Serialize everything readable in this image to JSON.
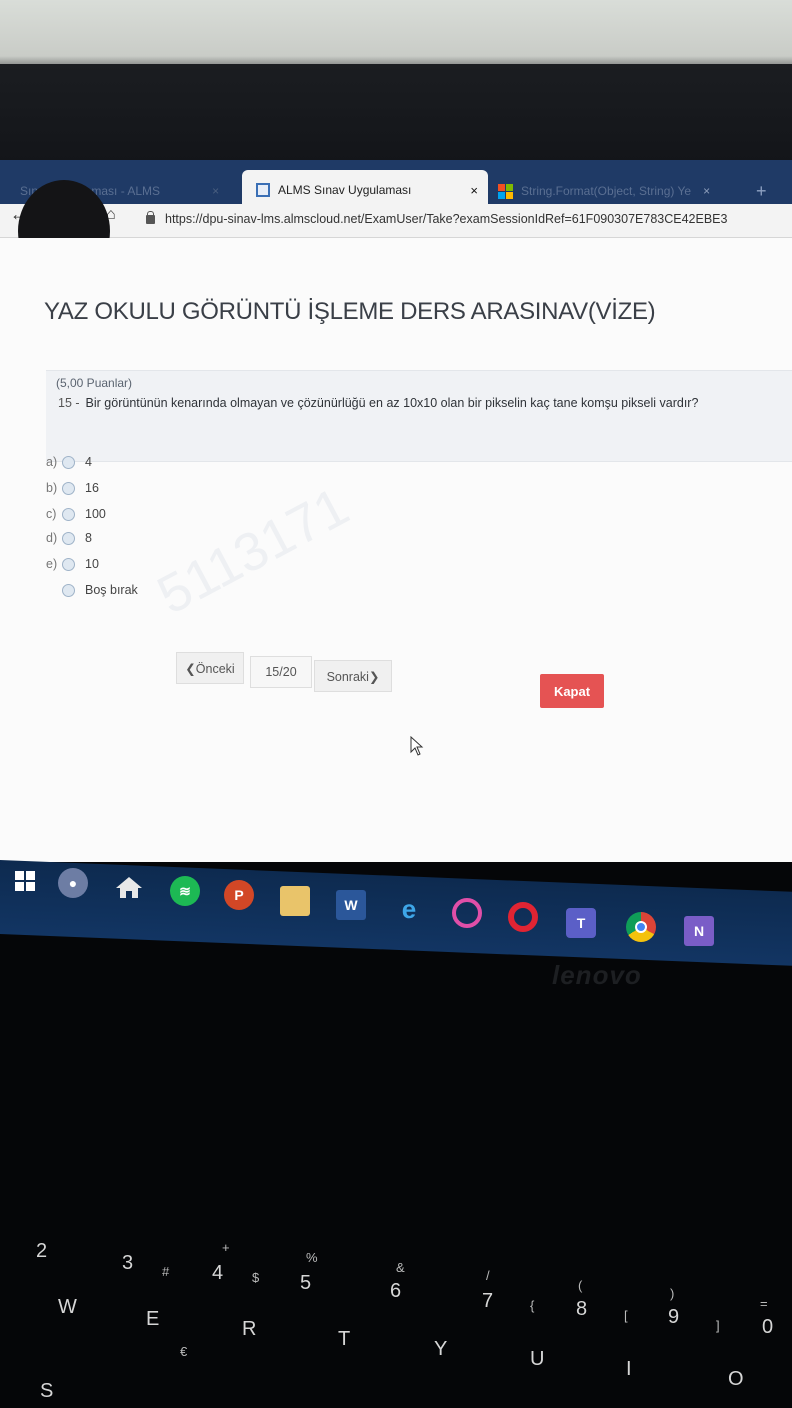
{
  "browser": {
    "tabs": [
      {
        "label": "Sınav Uygulaması - ALMS"
      },
      {
        "label": "ALMS Sınav Uygulaması",
        "close": "×"
      },
      {
        "label": "String.Format(Object, String) Ye",
        "close": "×"
      }
    ],
    "new_tab": "+",
    "url": "https://dpu-sinav-lms.almscloud.net/ExamUser/Take?examSessionIdRef=61F090307E783CE42EBE3"
  },
  "exam": {
    "title": "YAZ OKULU GÖRÜNTÜ İŞLEME DERS ARASINAV(VİZE)",
    "points": "(5,00 Puanlar)",
    "question_number": "15 -",
    "question_text": "Bir görüntünün kenarında olmayan ve çözünürlüğü en az 10x10 olan bir pikselin kaç tane komşu pikseli vardır?",
    "options": [
      {
        "letter": "a)",
        "value": "4"
      },
      {
        "letter": "b)",
        "value": "16"
      },
      {
        "letter": "c)",
        "value": "100"
      },
      {
        "letter": "d)",
        "value": "8"
      },
      {
        "letter": "e)",
        "value": "10"
      },
      {
        "letter": "",
        "value": "Boş bırak"
      }
    ],
    "watermark": "5113171"
  },
  "navigation": {
    "prev_label": "❮Önceki",
    "page_indicator": "15/20",
    "next_label": "Sonraki❯",
    "close_label": "Kapat"
  },
  "taskbar": {
    "apps": [
      "windows-start-icon",
      "cortana-icon",
      "home-icon",
      "spotify-icon",
      "powerpoint-icon",
      "file-explorer-icon",
      "word-icon",
      "edge-icon",
      "opera-gx-icon",
      "opera-icon",
      "teams-icon",
      "chrome-icon",
      "visual-studio-icon"
    ],
    "brand": "lenovo"
  },
  "keyboard": {
    "keys": [
      "2",
      "3",
      "#",
      "4",
      "$",
      "+",
      "%",
      "5",
      "&",
      "6",
      "/",
      "7",
      "{",
      "(",
      "8",
      "[",
      ")",
      "9",
      "]",
      "=",
      "0",
      "W",
      "E",
      "€",
      "R",
      "T",
      "Y",
      "U",
      "I",
      "O",
      "S"
    ]
  },
  "colors": {
    "tab_bar": "#1f3a66",
    "close_button": "#e55353",
    "taskbar": "#123563"
  }
}
